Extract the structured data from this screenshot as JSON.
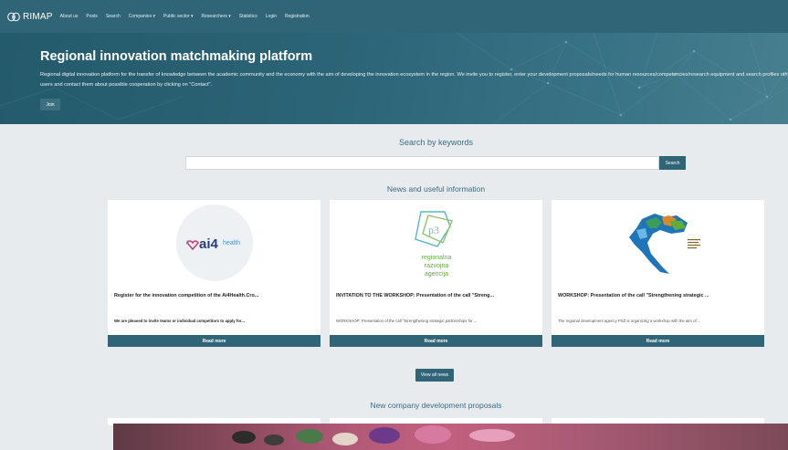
{
  "brand": {
    "name": "RIMAP"
  },
  "nav": [
    "About us",
    "Posts",
    "Search",
    "Companies ▾",
    "Public sector ▾",
    "Researchers ▾",
    "Statistics",
    "Login",
    "Registration"
  ],
  "hero": {
    "title": "Regional innovation matchmaking platform",
    "text": "Regional digital innovation platform for the transfer of knowledge between the academic community and the economy with the aim of developing the innovation ecosystem in the region. We invite you to register, enter your development proposals/needs for human resources/competencies/research equipment and search profiles other users and contact them about possible cooperation by clicking on \"Contact\".",
    "join_label": "Join"
  },
  "search": {
    "title": "Search by keywords",
    "value": "",
    "button_label": "Search"
  },
  "news": {
    "title": "News and useful information",
    "cards": [
      {
        "logo_text": "ai4",
        "logo_sub": "health",
        "title": "Register for the innovation competition of the Ai4Health.Cro...",
        "desc": "We are pleased to invite teams or individual competitors to apply for...",
        "read_label": "Read more"
      },
      {
        "logo_text": "p3",
        "logo_sub": "regionalna razvojna agencija",
        "title": "INVITATION TO THE WORKSHOP: Presentation of the call \"Streng...",
        "desc": "WORKSHOP: Presentation of the call \"Strengthening strategic partnerships for ...",
        "read_label": "Read more"
      },
      {
        "title": "WORKSHOP: Presentation of the call \"Strengthening strategic ...",
        "desc": "The regional development agency PSŽ is organizing a workshop with the aim of ...",
        "read_label": "Read more"
      }
    ],
    "view_all_label": "View all news"
  },
  "proposals": {
    "title": "New company development proposals"
  },
  "colors": {
    "primary": "#2f6577",
    "accent_green": "#5fae3c",
    "accent_blue": "#4a8fc8"
  }
}
